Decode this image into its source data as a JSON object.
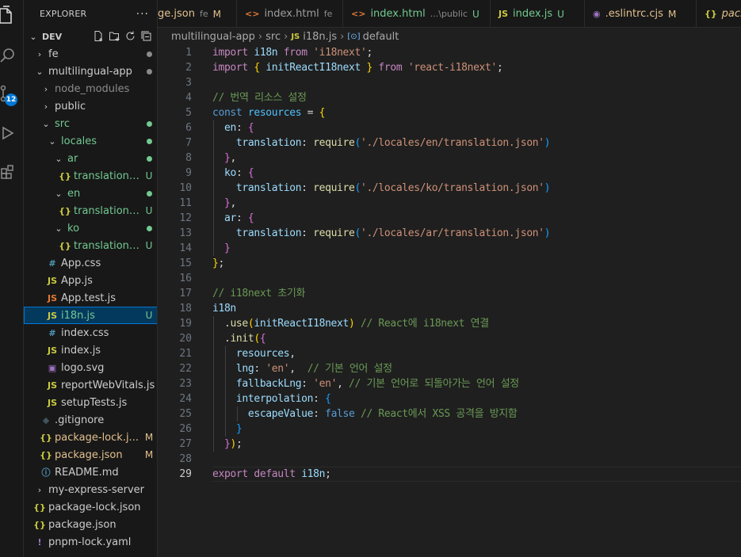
{
  "explorer": {
    "title": "EXPLORER",
    "more": "···",
    "root": "DEV",
    "items": [
      {
        "label": "fe",
        "kind": "folder",
        "chev": "›",
        "depth": 1,
        "dot": "#8b8b8b"
      },
      {
        "label": "multilingual-app",
        "kind": "folder",
        "chev": "⌄",
        "depth": 1,
        "dot": "#8b8b8b"
      },
      {
        "label": "node_modules",
        "kind": "folder",
        "chev": "›",
        "depth": 2,
        "muted": true
      },
      {
        "label": "public",
        "kind": "folder",
        "chev": "›",
        "depth": 2
      },
      {
        "label": "src",
        "kind": "folder",
        "chev": "⌄",
        "depth": 2,
        "dot": "#73c991",
        "color": "#73c991"
      },
      {
        "label": "locales",
        "kind": "folder",
        "chev": "⌄",
        "depth": 3,
        "dot": "#73c991",
        "color": "#73c991"
      },
      {
        "label": "ar",
        "kind": "folder",
        "chev": "⌄",
        "depth": 4,
        "dot": "#73c991",
        "color": "#73c991"
      },
      {
        "label": "translation....",
        "kind": "json",
        "depth": 5,
        "badge": "U",
        "color": "#73c991"
      },
      {
        "label": "en",
        "kind": "folder",
        "chev": "⌄",
        "depth": 4,
        "dot": "#73c991",
        "color": "#73c991"
      },
      {
        "label": "translation....",
        "kind": "json",
        "depth": 5,
        "badge": "U",
        "color": "#73c991"
      },
      {
        "label": "ko",
        "kind": "folder",
        "chev": "⌄",
        "depth": 4,
        "dot": "#73c991",
        "color": "#73c991"
      },
      {
        "label": "translation....",
        "kind": "json",
        "depth": 5,
        "badge": "U",
        "color": "#73c991"
      },
      {
        "label": "App.css",
        "kind": "css",
        "depth": 3
      },
      {
        "label": "App.js",
        "kind": "js",
        "depth": 3
      },
      {
        "label": "App.test.js",
        "kind": "jstest",
        "depth": 3
      },
      {
        "label": "i18n.js",
        "kind": "js",
        "depth": 3,
        "badge": "U",
        "color": "#73c991",
        "selected": true
      },
      {
        "label": "index.css",
        "kind": "css",
        "depth": 3
      },
      {
        "label": "index.js",
        "kind": "js",
        "depth": 3
      },
      {
        "label": "logo.svg",
        "kind": "svg",
        "depth": 3
      },
      {
        "label": "reportWebVitals.js",
        "kind": "js",
        "depth": 3
      },
      {
        "label": "setupTests.js",
        "kind": "js",
        "depth": 3
      },
      {
        "label": ".gitignore",
        "kind": "git",
        "depth": 2
      },
      {
        "label": "package-lock.j...",
        "kind": "json",
        "depth": 2,
        "badge": "M",
        "color": "#e2c08d"
      },
      {
        "label": "package.json",
        "kind": "json",
        "depth": 2,
        "badge": "M",
        "color": "#e2c08d"
      },
      {
        "label": "README.md",
        "kind": "info",
        "depth": 2
      },
      {
        "label": "my-express-server",
        "kind": "folder",
        "chev": "›",
        "depth": 1
      },
      {
        "label": "package-lock.json",
        "kind": "json",
        "depth": 1
      },
      {
        "label": "package.json",
        "kind": "json",
        "depth": 1
      },
      {
        "label": "pnpm-lock.yaml",
        "kind": "yaml",
        "depth": 1
      }
    ]
  },
  "activity": {
    "badge": "12"
  },
  "tabs": [
    {
      "label": "ge.json",
      "icon": "",
      "desc": "fe",
      "status": "M",
      "status_color": "#e2c08d",
      "label_color": "#e2c08d"
    },
    {
      "label": "index.html",
      "icon": "<>",
      "icon_color": "#e37933",
      "desc": "fe",
      "status": ""
    },
    {
      "label": "index.html",
      "icon": "<>",
      "icon_color": "#e37933",
      "desc": "...\\public",
      "status": "U",
      "status_color": "#73c991",
      "label_color": "#73c991"
    },
    {
      "label": "index.js",
      "icon": "JS",
      "icon_color": "#cbcb41",
      "desc": "",
      "status": "U",
      "status_color": "#73c991",
      "label_color": "#73c991"
    },
    {
      "label": ".eslintrc.cjs",
      "icon": "◉",
      "icon_color": "#a074c4",
      "desc": "",
      "status": "M",
      "status_color": "#e2c08d",
      "label_color": "#e2c08d"
    },
    {
      "label": "pack",
      "icon": "{}",
      "icon_color": "#cbcb41",
      "desc": "",
      "status": "",
      "label_color": "#e2c08d",
      "italic": true
    }
  ],
  "breadcrumb": {
    "parts": [
      "multilingual-app",
      "src",
      "i18n.js",
      "default"
    ],
    "sep": "›",
    "file_icon": "JS",
    "symbol_icon": "[⊙]"
  },
  "editor": {
    "current_line": 29,
    "lines": [
      [
        [
          "kw2",
          "import"
        ],
        [
          "pl",
          " "
        ],
        [
          "id",
          "i18n"
        ],
        [
          "pl",
          " "
        ],
        [
          "kw2",
          "from"
        ],
        [
          "pl",
          " "
        ],
        [
          "str",
          "'i18next'"
        ],
        [
          "pl",
          ";"
        ]
      ],
      [
        [
          "kw2",
          "import"
        ],
        [
          "pl",
          " "
        ],
        [
          "br1",
          "{"
        ],
        [
          "pl",
          " "
        ],
        [
          "id",
          "initReactI18next"
        ],
        [
          "pl",
          " "
        ],
        [
          "br1",
          "}"
        ],
        [
          "pl",
          " "
        ],
        [
          "kw2",
          "from"
        ],
        [
          "pl",
          " "
        ],
        [
          "str",
          "'react-i18next'"
        ],
        [
          "pl",
          ";"
        ]
      ],
      [],
      [
        [
          "cm",
          "// 번역 리소스 설정"
        ]
      ],
      [
        [
          "kw",
          "const"
        ],
        [
          "pl",
          " "
        ],
        [
          "cn",
          "resources"
        ],
        [
          "pl",
          " = "
        ],
        [
          "br1",
          "{"
        ]
      ],
      [
        [
          "pl",
          "  "
        ],
        [
          "id",
          "en"
        ],
        [
          "pl",
          ": "
        ],
        [
          "br2",
          "{"
        ]
      ],
      [
        [
          "pl",
          "    "
        ],
        [
          "id",
          "translation"
        ],
        [
          "pl",
          ": "
        ],
        [
          "fn",
          "require"
        ],
        [
          "br3",
          "("
        ],
        [
          "str",
          "'./locales/en/translation.json'"
        ],
        [
          "br3",
          ")"
        ]
      ],
      [
        [
          "pl",
          "  "
        ],
        [
          "br2",
          "}"
        ],
        [
          "pl",
          ","
        ]
      ],
      [
        [
          "pl",
          "  "
        ],
        [
          "id",
          "ko"
        ],
        [
          "pl",
          ": "
        ],
        [
          "br2",
          "{"
        ]
      ],
      [
        [
          "pl",
          "    "
        ],
        [
          "id",
          "translation"
        ],
        [
          "pl",
          ": "
        ],
        [
          "fn",
          "require"
        ],
        [
          "br3",
          "("
        ],
        [
          "str",
          "'./locales/ko/translation.json'"
        ],
        [
          "br3",
          ")"
        ]
      ],
      [
        [
          "pl",
          "  "
        ],
        [
          "br2",
          "}"
        ],
        [
          "pl",
          ","
        ]
      ],
      [
        [
          "pl",
          "  "
        ],
        [
          "id",
          "ar"
        ],
        [
          "pl",
          ": "
        ],
        [
          "br2",
          "{"
        ]
      ],
      [
        [
          "pl",
          "    "
        ],
        [
          "id",
          "translation"
        ],
        [
          "pl",
          ": "
        ],
        [
          "fn",
          "require"
        ],
        [
          "br3",
          "("
        ],
        [
          "str",
          "'./locales/ar/translation.json'"
        ],
        [
          "br3",
          ")"
        ]
      ],
      [
        [
          "pl",
          "  "
        ],
        [
          "br2",
          "}"
        ]
      ],
      [
        [
          "br1",
          "}"
        ],
        [
          "pl",
          ";"
        ]
      ],
      [],
      [
        [
          "cm",
          "// i18next 초기화"
        ]
      ],
      [
        [
          "id",
          "i18n"
        ]
      ],
      [
        [
          "pl",
          "  ."
        ],
        [
          "fn",
          "use"
        ],
        [
          "br1",
          "("
        ],
        [
          "id",
          "initReactI18next"
        ],
        [
          "br1",
          ")"
        ],
        [
          "pl",
          " "
        ],
        [
          "cm",
          "// React에 i18next 연결"
        ]
      ],
      [
        [
          "pl",
          "  ."
        ],
        [
          "fn",
          "init"
        ],
        [
          "br1",
          "("
        ],
        [
          "br2",
          "{"
        ]
      ],
      [
        [
          "pl",
          "    "
        ],
        [
          "id",
          "resources"
        ],
        [
          "pl",
          ","
        ]
      ],
      [
        [
          "pl",
          "    "
        ],
        [
          "id",
          "lng"
        ],
        [
          "pl",
          ": "
        ],
        [
          "str",
          "'en'"
        ],
        [
          "pl",
          ",  "
        ],
        [
          "cm",
          "// 기본 언어 설정"
        ]
      ],
      [
        [
          "pl",
          "    "
        ],
        [
          "id",
          "fallbackLng"
        ],
        [
          "pl",
          ": "
        ],
        [
          "str",
          "'en'"
        ],
        [
          "pl",
          ", "
        ],
        [
          "cm",
          "// 기본 언어로 되돌아가는 언어 설정"
        ]
      ],
      [
        [
          "pl",
          "    "
        ],
        [
          "id",
          "interpolation"
        ],
        [
          "pl",
          ": "
        ],
        [
          "br3",
          "{"
        ]
      ],
      [
        [
          "pl",
          "      "
        ],
        [
          "id",
          "escapeValue"
        ],
        [
          "pl",
          ": "
        ],
        [
          "kw",
          "false"
        ],
        [
          "pl",
          " "
        ],
        [
          "cm",
          "// React에서 XSS 공격을 방지함"
        ]
      ],
      [
        [
          "pl",
          "    "
        ],
        [
          "br3",
          "}"
        ]
      ],
      [
        [
          "pl",
          "  "
        ],
        [
          "br2",
          "}"
        ],
        [
          "br1",
          ")"
        ],
        [
          "pl",
          ";"
        ]
      ],
      [],
      [
        [
          "kw2",
          "export"
        ],
        [
          "pl",
          " "
        ],
        [
          "kw2",
          "default"
        ],
        [
          "pl",
          " "
        ],
        [
          "id",
          "i18n"
        ],
        [
          "pl",
          ";"
        ]
      ]
    ]
  }
}
